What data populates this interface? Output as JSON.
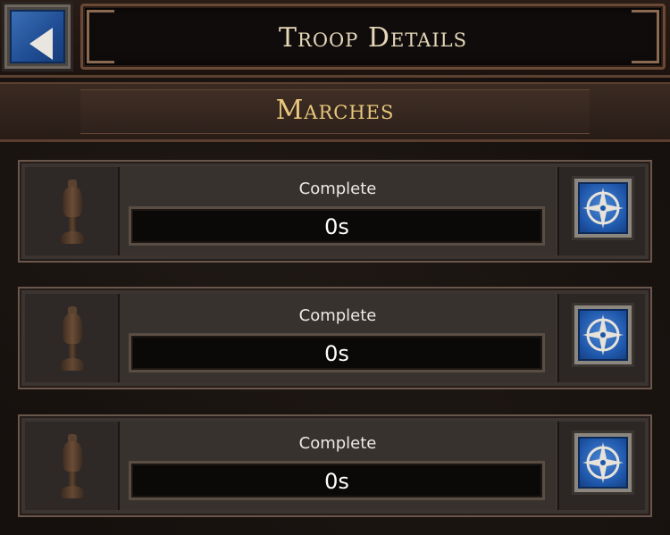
{
  "header": {
    "title": "Troop Details",
    "back_icon": "back-arrow-icon"
  },
  "section": {
    "title": "Marches"
  },
  "marches": [
    {
      "status": "Complete",
      "time": "0s",
      "icon": "urn-icon",
      "action_icon": "compass-icon"
    },
    {
      "status": "Complete",
      "time": "0s",
      "icon": "urn-icon",
      "action_icon": "compass-icon"
    },
    {
      "status": "Complete",
      "time": "0s",
      "icon": "urn-icon",
      "action_icon": "compass-icon"
    }
  ],
  "colors": {
    "title": "#e6d7b8",
    "section_title": "#e8c77c",
    "button_blue": "#2a62b8"
  }
}
